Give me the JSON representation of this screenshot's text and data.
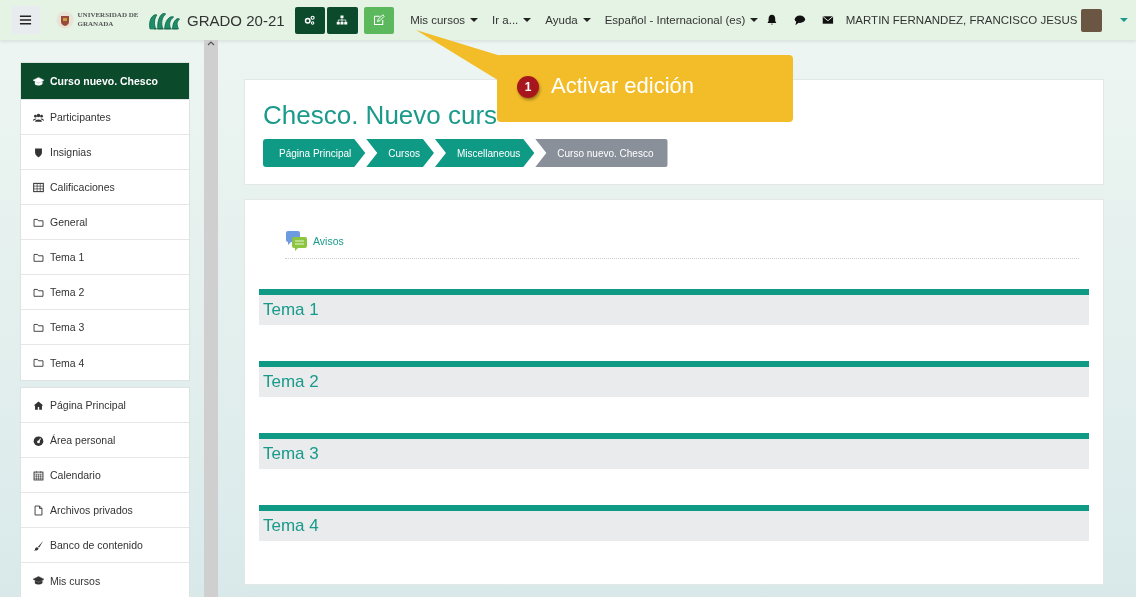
{
  "navbar": {
    "brand_university": "UNIVERSIDAD DE GRANADA",
    "site_name": "GRADO 20-21",
    "tool_buttons": [
      {
        "kind": "cogs",
        "selected": false
      },
      {
        "kind": "sitemap",
        "selected": false
      },
      {
        "kind": "edit",
        "selected": true
      }
    ],
    "menus": [
      {
        "label": "Mis cursos"
      },
      {
        "label": "Ir a..."
      },
      {
        "label": "Ayuda"
      },
      {
        "label": "Español - Internacional (es)"
      }
    ],
    "user_name": "MARTIN FERNANDEZ, FRANCISCO JESUS"
  },
  "sidebar": {
    "groups": [
      [
        {
          "label": "Curso nuevo. Chesco",
          "kind": "course",
          "selected": true
        },
        {
          "label": "Participantes",
          "kind": "users",
          "selected": false
        },
        {
          "label": "Insignias",
          "kind": "shield",
          "selected": false
        },
        {
          "label": "Calificaciones",
          "kind": "table",
          "selected": false
        },
        {
          "label": "General",
          "kind": "folder",
          "selected": false
        },
        {
          "label": "Tema 1",
          "kind": "folder",
          "selected": false
        },
        {
          "label": "Tema 2",
          "kind": "folder",
          "selected": false
        },
        {
          "label": "Tema 3",
          "kind": "folder",
          "selected": false
        },
        {
          "label": "Tema 4",
          "kind": "folder",
          "selected": false
        }
      ],
      [
        {
          "label": "Página Principal",
          "kind": "home",
          "selected": false
        },
        {
          "label": "Área personal",
          "kind": "dashboard",
          "selected": false
        },
        {
          "label": "Calendario",
          "kind": "calendar",
          "selected": false
        },
        {
          "label": "Archivos privados",
          "kind": "file",
          "selected": false
        },
        {
          "label": "Banco de contenido",
          "kind": "brush",
          "selected": false
        },
        {
          "label": "Mis cursos",
          "kind": "course",
          "selected": false
        }
      ]
    ]
  },
  "page_header": {
    "title": "Chesco. Nuevo curs",
    "breadcrumb": [
      {
        "label": "Página Principal",
        "selected": false
      },
      {
        "label": "Cursos",
        "selected": false
      },
      {
        "label": "Miscellaneous",
        "selected": false
      },
      {
        "label": "Curso nuevo. Chesco",
        "selected": true
      }
    ]
  },
  "course": {
    "forum_link": "Avisos",
    "sections": [
      {
        "title": "Tema 1"
      },
      {
        "title": "Tema 2"
      },
      {
        "title": "Tema 3"
      },
      {
        "title": "Tema 4"
      }
    ]
  },
  "callout": {
    "number": "1",
    "text": "Activar edición"
  }
}
